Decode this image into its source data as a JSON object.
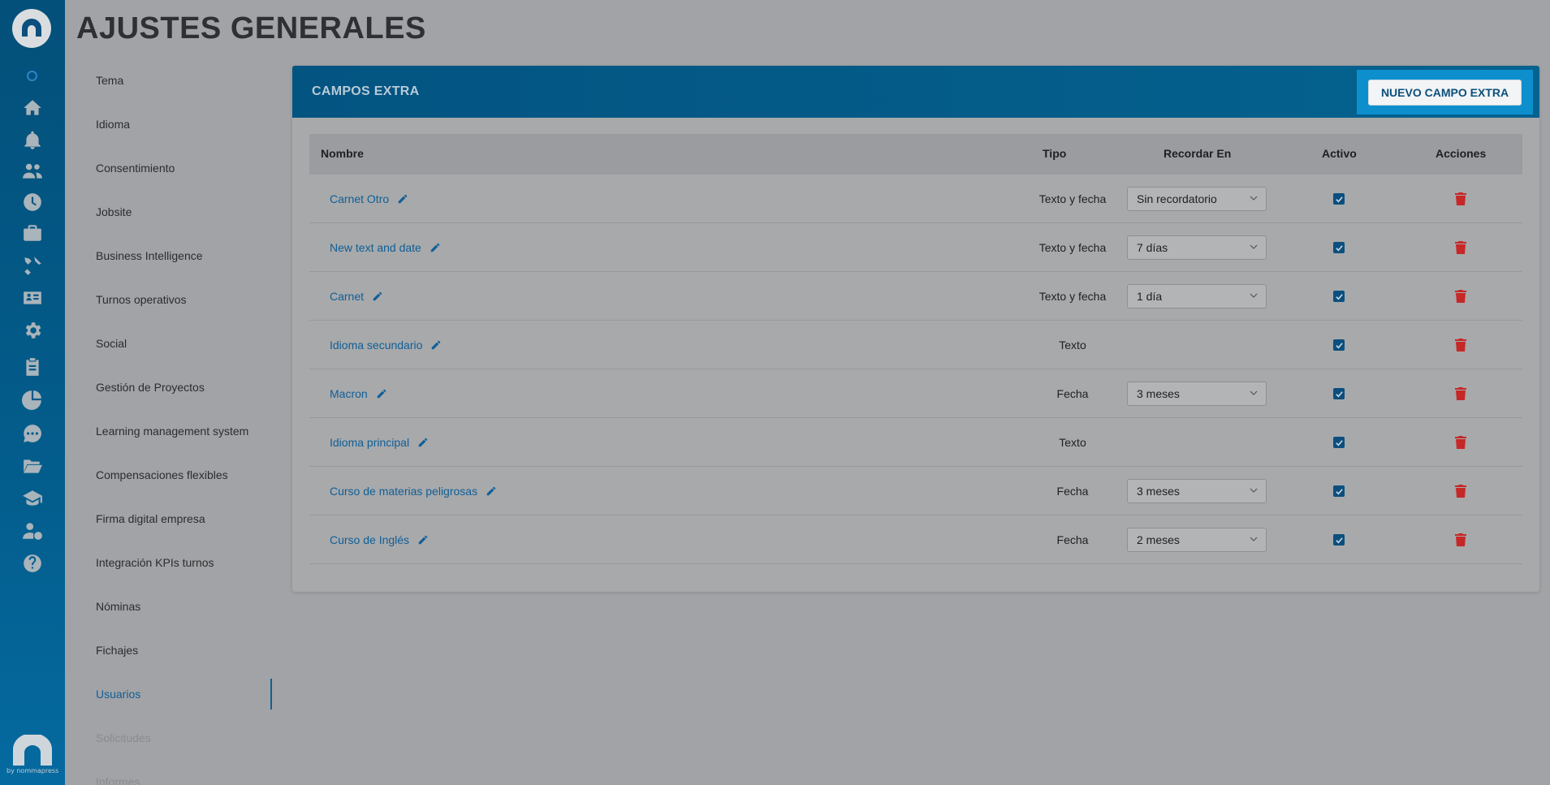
{
  "page": {
    "title": "AJUSTES GENERALES"
  },
  "rail": {
    "icons": [
      "logo-icon",
      "status-dot-icon",
      "home-icon",
      "bell-icon",
      "users-icon",
      "clock-icon",
      "briefcase-icon",
      "tools-icon",
      "id-card-icon",
      "gear-icon",
      "clipboard-icon",
      "pie-chart-icon",
      "chat-icon",
      "folder-icon",
      "graduation-cap-icon",
      "user-dollar-icon",
      "help-icon"
    ],
    "brand_text": "by nommapress"
  },
  "menu": {
    "items": [
      {
        "label": "Tema"
      },
      {
        "label": "Idioma"
      },
      {
        "label": "Consentimiento"
      },
      {
        "label": "Jobsite"
      },
      {
        "label": "Business Intelligence"
      },
      {
        "label": "Turnos operativos"
      },
      {
        "label": "Social"
      },
      {
        "label": "Gestión de Proyectos"
      },
      {
        "label": "Learning management system"
      },
      {
        "label": "Compensaciones flexibles"
      },
      {
        "label": "Firma digital empresa"
      },
      {
        "label": "Integración KPIs turnos"
      },
      {
        "label": "Nóminas"
      },
      {
        "label": "Fichajes"
      },
      {
        "label": "Usuarios"
      },
      {
        "label": "Solicitudes"
      },
      {
        "label": "Informes"
      }
    ],
    "active": "Usuarios"
  },
  "panel": {
    "title": "CAMPOS EXTRA",
    "new_button": "NUEVO CAMPO EXTRA",
    "columns": {
      "name": "Nombre",
      "type": "Tipo",
      "remind": "Recordar En",
      "active": "Activo",
      "actions": "Acciones"
    },
    "rows": [
      {
        "name": "Carnet Otro",
        "type": "Texto y fecha",
        "remind": "Sin recordatorio",
        "active": true
      },
      {
        "name": "New text and date",
        "type": "Texto y fecha",
        "remind": "7 días",
        "active": true
      },
      {
        "name": "Carnet",
        "type": "Texto y fecha",
        "remind": "1 día",
        "active": true
      },
      {
        "name": "Idioma secundario",
        "type": "Texto",
        "remind": null,
        "active": true
      },
      {
        "name": "Macron",
        "type": "Fecha",
        "remind": "3 meses",
        "active": true
      },
      {
        "name": "Idioma principal",
        "type": "Texto",
        "remind": null,
        "active": true
      },
      {
        "name": "Curso de materias peligrosas",
        "type": "Fecha",
        "remind": "3 meses",
        "active": true
      },
      {
        "name": "Curso de Inglés",
        "type": "Fecha",
        "remind": "2 meses",
        "active": true
      }
    ]
  },
  "colors": {
    "accent": "#0f5f96",
    "danger": "#c62828",
    "rail": "#035d8c"
  }
}
